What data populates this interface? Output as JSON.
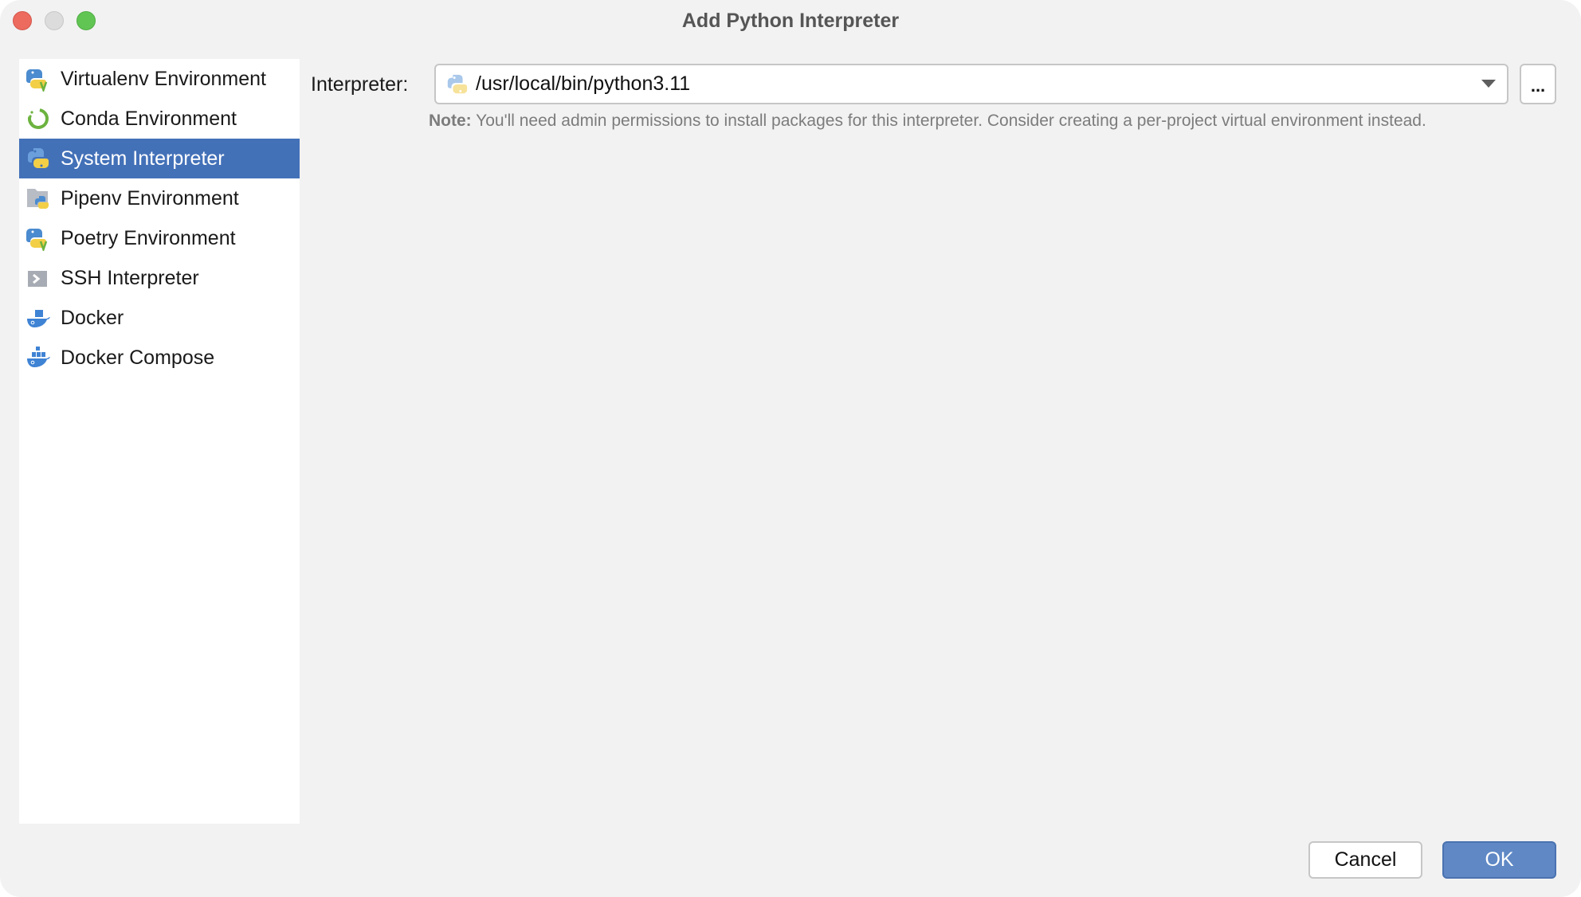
{
  "window": {
    "title": "Add Python Interpreter",
    "controls": [
      "close",
      "minimize",
      "maximize"
    ]
  },
  "sidebar": {
    "selected_index": 2,
    "items": [
      {
        "label": "Virtualenv Environment",
        "icon": "virtualenv-icon"
      },
      {
        "label": "Conda Environment",
        "icon": "conda-icon"
      },
      {
        "label": "System Interpreter",
        "icon": "python-icon"
      },
      {
        "label": "Pipenv Environment",
        "icon": "pipenv-icon"
      },
      {
        "label": "Poetry Environment",
        "icon": "poetry-icon"
      },
      {
        "label": "SSH Interpreter",
        "icon": "ssh-icon"
      },
      {
        "label": "Docker",
        "icon": "docker-icon"
      },
      {
        "label": "Docker Compose",
        "icon": "docker-compose-icon"
      }
    ]
  },
  "form": {
    "interpreter_label": "Interpreter:",
    "interpreter_value": "/usr/local/bin/python3.11",
    "browse_label": "...",
    "note_prefix": "Note:",
    "note_text": " You'll need admin permissions to install packages for this interpreter. Consider creating a per-project virtual environment instead."
  },
  "footer": {
    "cancel_label": "Cancel",
    "ok_label": "OK"
  },
  "colors": {
    "selection": "#4371b8",
    "ok_button": "#5f88c5",
    "python_blue": "#4b8bcf",
    "python_yellow": "#f2cf46",
    "conda_green": "#6cb33f",
    "docker_blue": "#3f83d4"
  }
}
